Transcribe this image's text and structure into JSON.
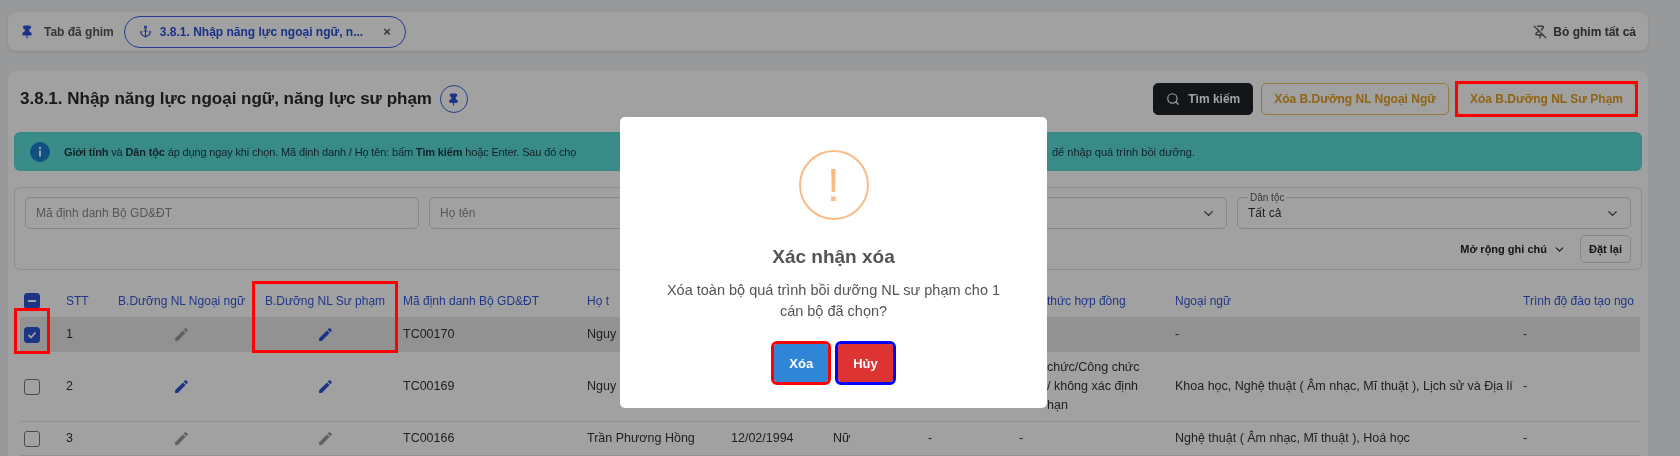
{
  "pinned_bar": {
    "label": "Tab đã ghim",
    "tabs": [
      {
        "label": "3.8.1. Nhập năng lực ngoại ngữ, n...",
        "close": "×"
      }
    ],
    "unpin_all": "Bỏ ghim tất cả"
  },
  "page": {
    "title": "3.8.1. Nhập năng lực ngoại ngữ, năng lực sư phạm",
    "actions": [
      {
        "kind": "search",
        "label": "Tìm kiếm",
        "framed": false
      },
      {
        "kind": "outline",
        "label": "Xóa B.Dưỡng NL Ngoại Ngữ",
        "framed": false
      },
      {
        "kind": "outline",
        "label": "Xóa B.Dưỡng NL Sư Phạm",
        "framed": true
      }
    ]
  },
  "info_banner": {
    "text": "**Giới tính** và **Dân tộc** áp dụng ngay khi chọn. Mã định danh / Họ tên: bấm **Tìm kiếm** hoặc Enter. Sau đó chọ",
    "text_after_dialog": "để nhập quá trình bồi dưỡng."
  },
  "filters": {
    "fields": [
      {
        "kind": "input",
        "placeholder": "Mã định danh Bộ GD&ĐT"
      },
      {
        "kind": "input",
        "placeholder": "Họ tên"
      },
      {
        "kind": "select"
      },
      {
        "kind": "select",
        "label": "Dân tộc",
        "value": "Tất cả"
      }
    ],
    "expand_notes": "Mở rộng ghi chú",
    "reset": "Đặt lại"
  },
  "table": {
    "header_checkbox": {
      "indeterminate": true
    },
    "columns": [
      {
        "kind": "check"
      },
      {
        "kind": "text",
        "label": "STT"
      },
      {
        "kind": "edit",
        "label": "B.Dưỡng NL Ngoại ngữ",
        "framed": false
      },
      {
        "kind": "edit",
        "label": "B.Dưỡng NL Sư phạm",
        "framed": true
      },
      {
        "kind": "text",
        "label": "Mã định danh Bộ GD&ĐT"
      },
      {
        "kind": "text",
        "label": "Họ t"
      },
      {
        "kind": "text"
      },
      {
        "kind": "text"
      },
      {
        "kind": "text"
      },
      {
        "kind": "covered",
        "label": "thức hợp đồng"
      },
      {
        "kind": "text",
        "label": "Ngoại ngữ"
      },
      {
        "kind": "text",
        "label": "Trình độ đào tạo ngo"
      }
    ],
    "rows": [
      {
        "selected": true,
        "checked": true,
        "checkbox_framed": true,
        "stt": "1",
        "ngoai_ngu_edit_active": false,
        "su_pham_edit_active": true,
        "ma_dinh_danh": "TC00170",
        "ho_ten": "Nguy",
        "ngoai_ngu": "-",
        "trinh_do": "-"
      },
      {
        "selected": false,
        "checked": false,
        "checkbox_framed": false,
        "stt": "2",
        "ngoai_ngu_edit_active": true,
        "su_pham_edit_active": true,
        "ma_dinh_danh": "TC00169",
        "ho_ten": "Nguy",
        "hinh_thuc_hop_dong": [
          "chức/Công chức",
          "/ không xác định",
          "hạn"
        ],
        "ngoai_ngu": "Khoa học, Nghệ thuật ( Âm nhạc, Mĩ thuật ), Lịch sử và Địa lí",
        "trinh_do": "-"
      },
      {
        "selected": false,
        "checked": false,
        "checkbox_framed": false,
        "stt": "3",
        "ngoai_ngu_edit_active": false,
        "su_pham_edit_active": false,
        "ma_dinh_danh": "TC00166",
        "ho_ten": "Trần Phương Hồng",
        "ngay_sinh": "12/02/1994",
        "gioi_tinh": "Nữ",
        "column_9": "-",
        "hinh_thuc_hop_dong": "-",
        "ngoai_ngu": "Nghệ thuật ( Âm nhạc, Mĩ thuật ), Hoá học",
        "trinh_do": "-"
      }
    ]
  },
  "dialog": {
    "title": "Xác nhận xóa",
    "icon": "!",
    "message": "Xóa toàn bộ quá trình bồi dưỡng NL sư phạm cho 1 cán bộ đã chọn?",
    "buttons": [
      {
        "kind": "confirm",
        "label": "Xóa",
        "framed": true,
        "focused": false
      },
      {
        "kind": "cancel",
        "label": "Hủy",
        "framed": false,
        "focused": true
      }
    ]
  }
}
